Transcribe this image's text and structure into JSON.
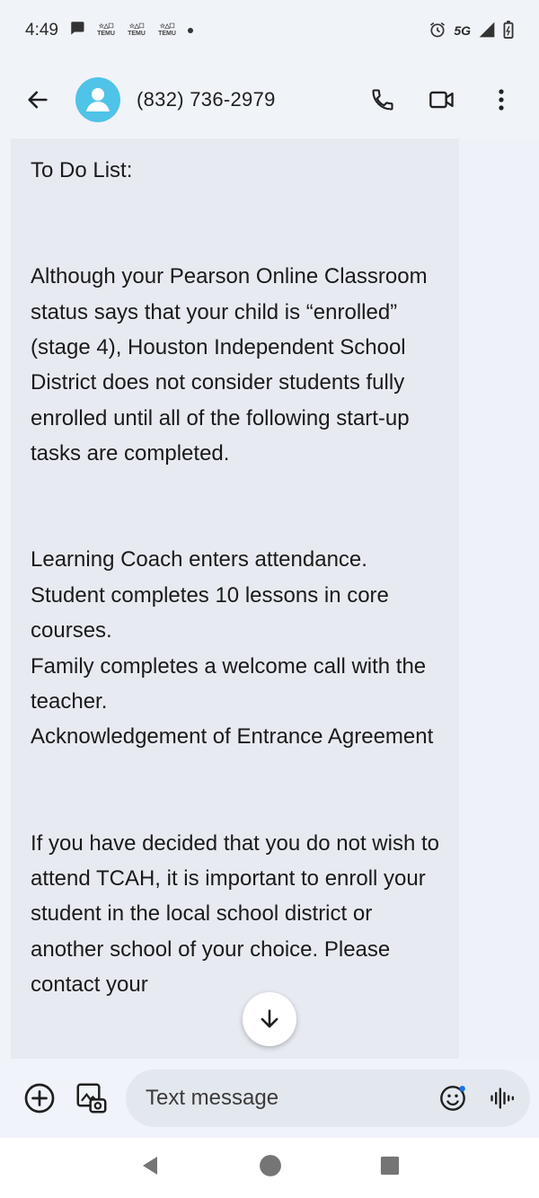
{
  "status_bar": {
    "time": "4:49",
    "notification_labels": [
      "TEMU",
      "TEMU",
      "TEMU"
    ],
    "network": "5G"
  },
  "app_bar": {
    "contact": "(832) 736-2979"
  },
  "message": {
    "paragraphs": [
      "To Do List:",
      "Although your Pearson Online Classroom status says that your child is “enrolled” (stage 4), Houston Independent School District does not consider students fully enrolled until all of the following start-up tasks are completed.",
      "Learning Coach enters attendance.\nStudent completes 10 lessons in core courses.\nFamily completes a welcome call with the teacher.\nAcknowledgement of Entrance Agreement",
      "If you have decided that you do not wish to attend TCAH, it is important to enroll your student in the local school district or another school of your choice. Please contact your"
    ]
  },
  "compose": {
    "placeholder": "Text message"
  },
  "colors": {
    "avatar": "#4fc3e8",
    "bubble": "#e7eaf1",
    "background": "#f0f3f8"
  }
}
